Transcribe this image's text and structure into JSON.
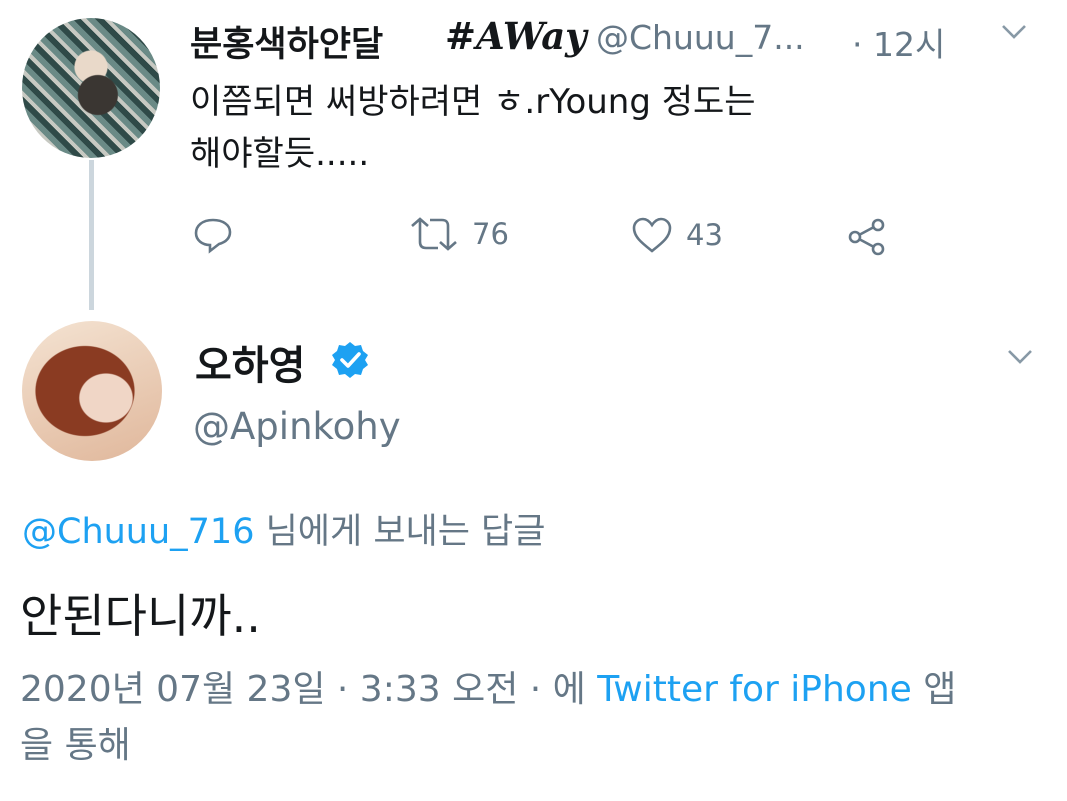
{
  "tweet_parent": {
    "display_name": "분홍색하얀달",
    "hashtag": "#AWay",
    "handle": "@Chuuu_7...",
    "time": "· 12시",
    "text_line1": "이쯤되면 써방하려면 ㅎ.rYoung 정도는",
    "text_line2": "해야할듯.....",
    "retweet_count": "76",
    "like_count": "43"
  },
  "tweet_reply": {
    "display_name": "오하영",
    "handle": "@Apinkohy",
    "replying_mention": "@Chuuu_716",
    "replying_suffix": " 님에게 보내는 답글",
    "text": "안된다니까..",
    "meta_date": "2020년 07월 23일 · 3:33 오전 · 에 ",
    "meta_source": "Twitter for iPhone",
    "meta_suffix": " 앱을 통해"
  },
  "colors": {
    "accent": "#1da1f2",
    "muted": "#657786",
    "text": "#14171a",
    "thread_line": "#ccd6dd"
  },
  "icons": [
    "reply-icon",
    "retweet-icon",
    "like-icon",
    "share-icon",
    "verified-icon",
    "chevron-down-icon"
  ]
}
